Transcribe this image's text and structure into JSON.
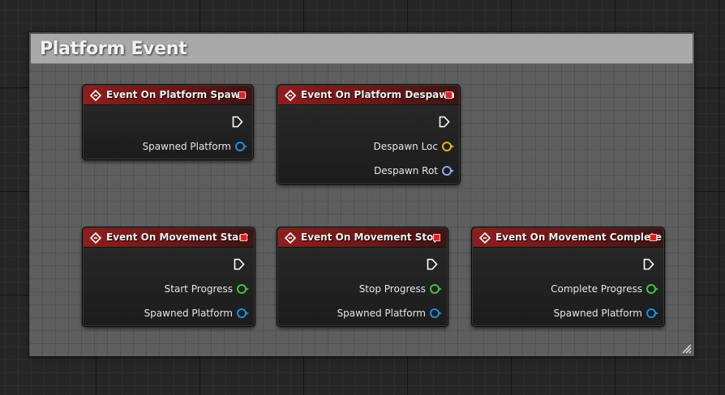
{
  "comment": {
    "title": "Platform Event"
  },
  "nodes": [
    {
      "title": "Event On Platform Spawn",
      "pins": [
        {
          "label": "Spawned Platform",
          "color": "#1e8fdc"
        }
      ]
    },
    {
      "title": "Event On Platform Despawn",
      "pins": [
        {
          "label": "Despawn Loc",
          "color": "#e8b417"
        },
        {
          "label": "Despawn Rot",
          "color": "#8ea7f0"
        }
      ]
    },
    {
      "title": "Event On Movement Start",
      "pins": [
        {
          "label": "Start Progress",
          "color": "#3cc43c"
        },
        {
          "label": "Spawned Platform",
          "color": "#1e8fdc"
        }
      ]
    },
    {
      "title": "Event On Movement Stop",
      "pins": [
        {
          "label": "Stop Progress",
          "color": "#3cc43c"
        },
        {
          "label": "Spawned Platform",
          "color": "#1e8fdc"
        }
      ]
    },
    {
      "title": "Event On Movement Complete",
      "pins": [
        {
          "label": "Complete Progress",
          "color": "#3cc43c"
        },
        {
          "label": "Spawned Platform",
          "color": "#1e8fdc"
        }
      ]
    }
  ],
  "icons": {
    "event": "event-diamond-icon",
    "exec": "exec-pin-icon",
    "delegate": "delegate-pin-icon",
    "resize": "resize-grip-icon"
  }
}
